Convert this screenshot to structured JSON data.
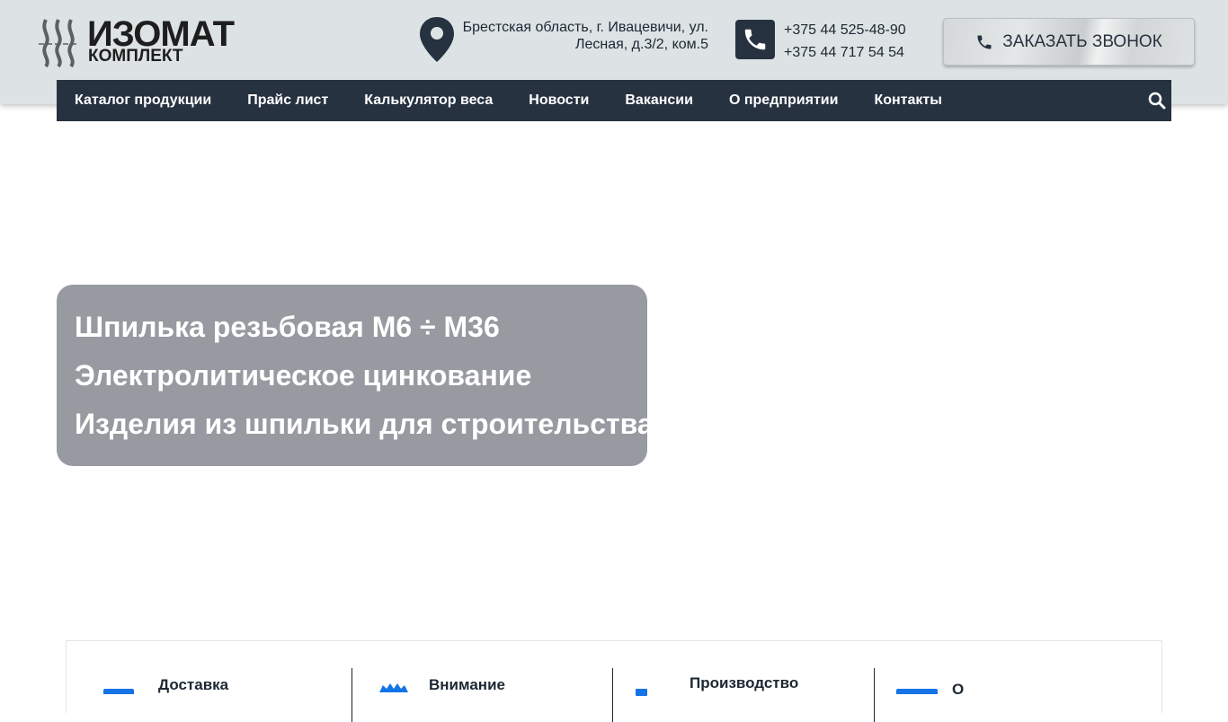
{
  "header": {
    "logo": {
      "word": "ИЗОМАТ",
      "sub": "КОМПЛЕКТ",
      "icon": "logo-mark"
    },
    "address": {
      "icon": "map-pin-icon",
      "line1": "Брестская область, г. Ивацевичи, ул.",
      "line2": "Лесная, д.3/2, ком.5"
    },
    "phones": {
      "icon": "phone-icon",
      "phone1": "+375 44 525-48-90",
      "phone2": "+375 44 717 54 54"
    },
    "callback_button": {
      "icon": "phone-icon",
      "label": "ЗАКАЗАТЬ ЗВОНОК"
    }
  },
  "nav": {
    "items": [
      {
        "label": "Каталог продукции"
      },
      {
        "label": "Прайс лист"
      },
      {
        "label": "Калькулятор веса"
      },
      {
        "label": "Новости"
      },
      {
        "label": "Вакансии"
      },
      {
        "label": "О предприятии"
      },
      {
        "label": "Контакты"
      }
    ],
    "search_icon": "search-icon"
  },
  "hero": {
    "lines": [
      "Шпилька резьбовая М6 ÷ М36",
      "Электролитическое цинкование",
      "Изделия из шпильки для строительства"
    ]
  },
  "features": {
    "items": [
      {
        "title": "Доставка",
        "icon": "delivery-icon"
      },
      {
        "title": "Внимание",
        "icon": "badge-icon"
      },
      {
        "title": "Производство",
        "icon": "factory-icon"
      },
      {
        "title": "О",
        "icon": "card-icon"
      }
    ]
  },
  "colors": {
    "header_bg": "#dde3e4",
    "nav_bg": "#263240",
    "hero_bg": "#979aa0",
    "accent_blue": "#1473e6"
  }
}
